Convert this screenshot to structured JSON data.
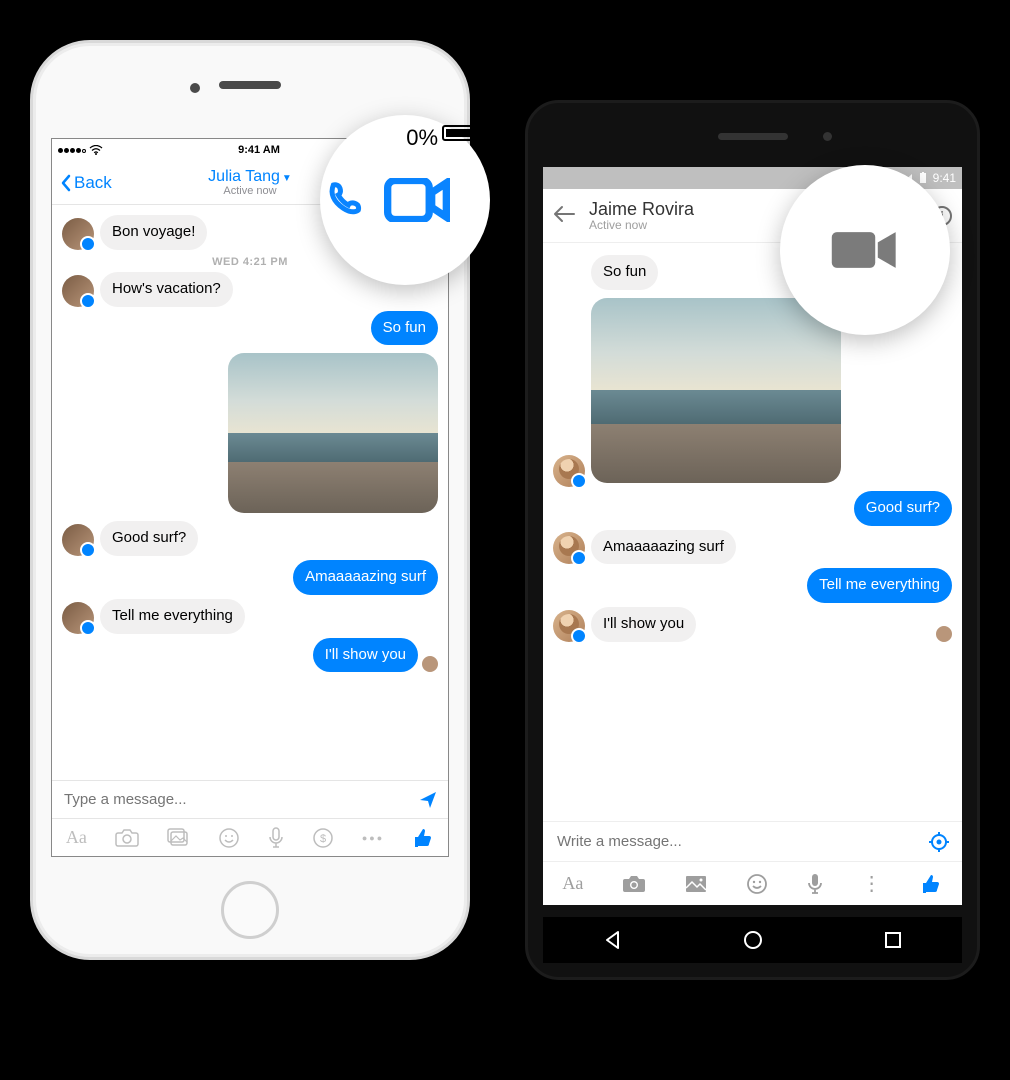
{
  "ios": {
    "status": {
      "clock": "9:41 AM",
      "battery_pct_zoom": "%",
      "pre_pct": "0"
    },
    "nav": {
      "back": "Back",
      "contact_name": "Julia Tang",
      "status_text": "Active now"
    },
    "timestamp": "WED 4:21 PM",
    "messages": {
      "m0": "Bon voyage!",
      "m1": "How's vacation?",
      "m2": "So fun",
      "m3": "Good surf?",
      "m4": "Amaaaaazing surf",
      "m5": "Tell me everything",
      "m6": "I'll show you"
    },
    "input_placeholder": "Type a message...",
    "toolbar": {
      "aa": "Aa",
      "more": "○○○"
    }
  },
  "android": {
    "status": {
      "clock": "9:41"
    },
    "header": {
      "contact_name": "Jaime Rovira",
      "status_text": "Active now"
    },
    "messages": {
      "m0": "So fun",
      "m1": "Good surf?",
      "m2": "Amaaaaazing surf",
      "m3": "Tell me everything",
      "m4": "I'll show you"
    },
    "input_placeholder": "Write a message...",
    "toolbar": {
      "aa": "Aa"
    }
  }
}
